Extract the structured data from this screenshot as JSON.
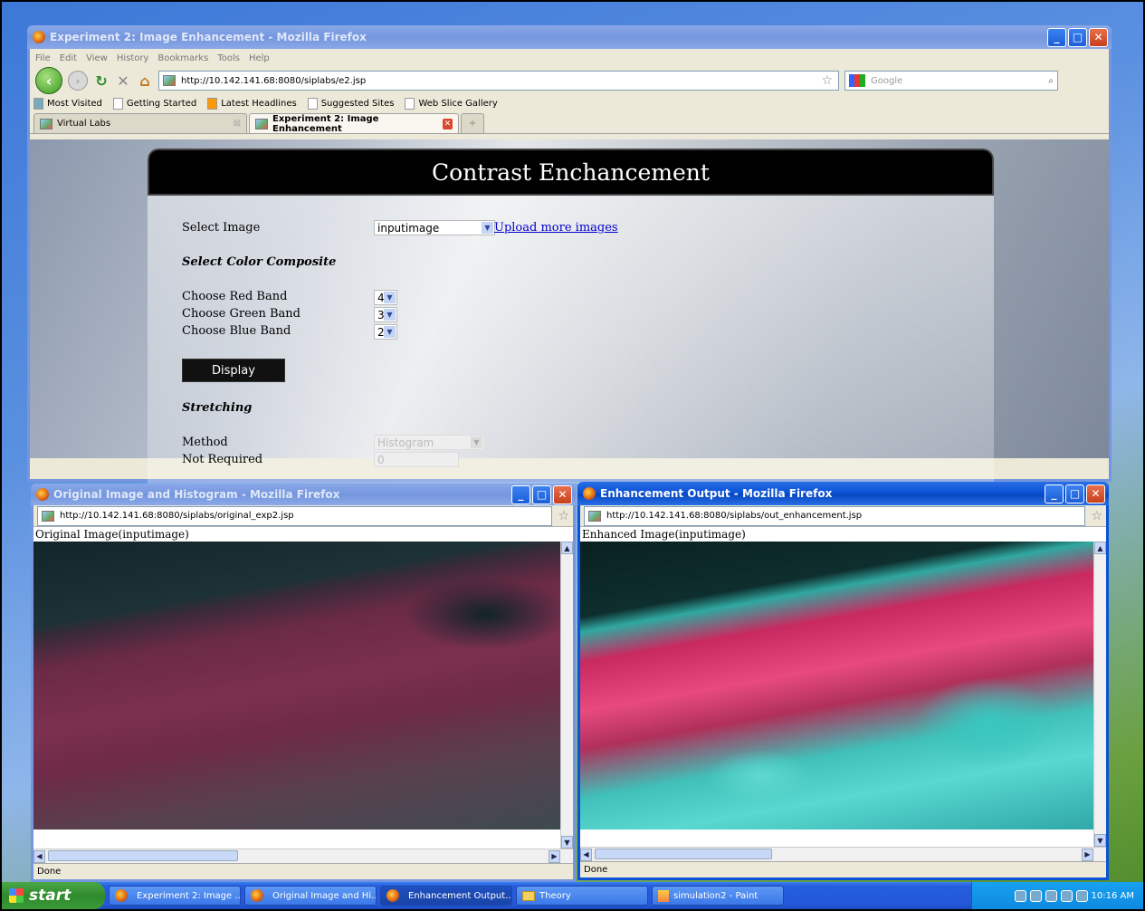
{
  "main_window": {
    "title": "Experiment 2: Image Enhancement - Mozilla Firefox",
    "menu": [
      "File",
      "Edit",
      "View",
      "History",
      "Bookmarks",
      "Tools",
      "Help"
    ],
    "url": "http://10.142.141.68:8080/siplabs/e2.jsp",
    "search_placeholder": "Google",
    "bookmarks": [
      "Most Visited",
      "Getting Started",
      "Latest Headlines",
      "Suggested Sites",
      "Web Slice Gallery"
    ],
    "tabs": [
      {
        "label": "Virtual Labs"
      },
      {
        "label": "Experiment 2: Image Enhancement"
      }
    ]
  },
  "page": {
    "header": "Contrast Enchancement",
    "select_image_label": "Select Image",
    "select_image_value": "inputimage",
    "upload_link": "Upload more images",
    "color_composite_heading": "Select Color Composite",
    "red_band_label": "Choose Red Band",
    "red_band_value": "4",
    "green_band_label": "Choose Green Band",
    "green_band_value": "3",
    "blue_band_label": "Choose Blue Band",
    "blue_band_value": "2",
    "display_button": "Display",
    "stretching_heading": "Stretching",
    "method_label": "Method",
    "method_value": "Histogram",
    "not_required_label": "Not Required",
    "not_required_value": "0"
  },
  "original_window": {
    "title": "Original Image and Histogram - Mozilla Firefox",
    "url": "http://10.142.141.68:8080/siplabs/original_exp2.jsp",
    "caption": "Original Image(inputimage)",
    "status": "Done"
  },
  "enhanced_window": {
    "title": "Enhancement Output - Mozilla Firefox",
    "url": "http://10.142.141.68:8080/siplabs/out_enhancement.jsp",
    "caption": "Enhanced Image(inputimage)",
    "status": "Done"
  },
  "taskbar": {
    "start": "start",
    "items": [
      "Experiment 2: Image ...",
      "Original Image and Hi...",
      "Enhancement Output...",
      "Theory",
      "simulation2 - Paint"
    ],
    "clock": "10:16 AM"
  },
  "colors": {
    "xp_blue": "#0a52d6",
    "start_green": "#2f8a2c",
    "link_blue": "#0000cc"
  }
}
